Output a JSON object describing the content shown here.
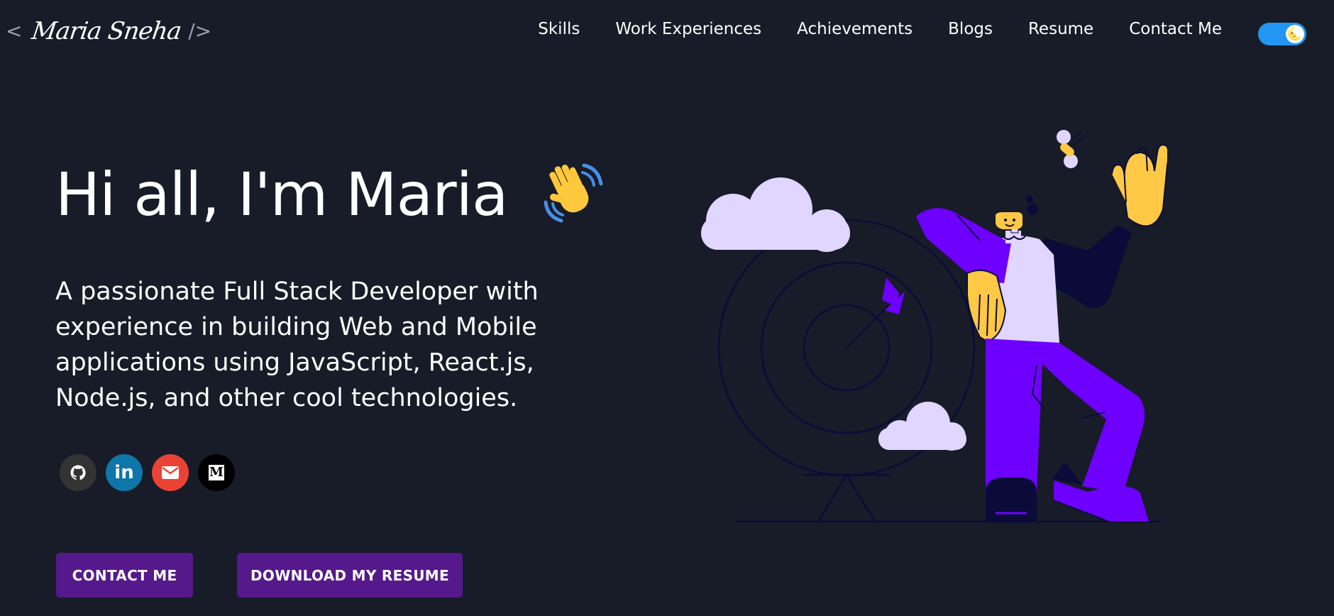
{
  "header": {
    "logo": {
      "open_bracket": "<",
      "name": "Maria Sneha",
      "close_bracket": "/>"
    },
    "nav": [
      {
        "label": "Skills"
      },
      {
        "label": "Work Experiences"
      },
      {
        "label": "Achievements"
      },
      {
        "label": "Blogs"
      },
      {
        "label": "Resume"
      },
      {
        "label": "Contact Me"
      }
    ],
    "theme_toggle": {
      "state": "dark",
      "icon": "moon-icon",
      "glyph": "🌜"
    }
  },
  "hero": {
    "title": "Hi all, I'm Maria",
    "title_icon": "waving-hand-icon",
    "subtitle": "A passionate Full Stack Developer with experience in building Web and Mobile applications using JavaScript, React.js, Node.js, and other cool technologies."
  },
  "social": [
    {
      "name": "github",
      "icon": "github-icon",
      "color": "#333333"
    },
    {
      "name": "linkedin",
      "icon": "linkedin-icon",
      "glyph": "in",
      "color": "#0e76a8"
    },
    {
      "name": "gmail",
      "icon": "mail-icon",
      "color": "#ea4335"
    },
    {
      "name": "medium",
      "icon": "medium-icon",
      "glyph": "M",
      "color": "#000000"
    }
  ],
  "buttons": {
    "contact": "CONTACT ME",
    "resume": "DOWNLOAD MY RESUME"
  },
  "colors": {
    "background": "#171c28",
    "accent": "#55198b",
    "toggle": "#2196f3",
    "illustration_purple": "#6e00ff",
    "illustration_lavender": "#e0d6ff",
    "illustration_yellow": "#ffc845",
    "illustration_line": "#0b0b3a"
  }
}
